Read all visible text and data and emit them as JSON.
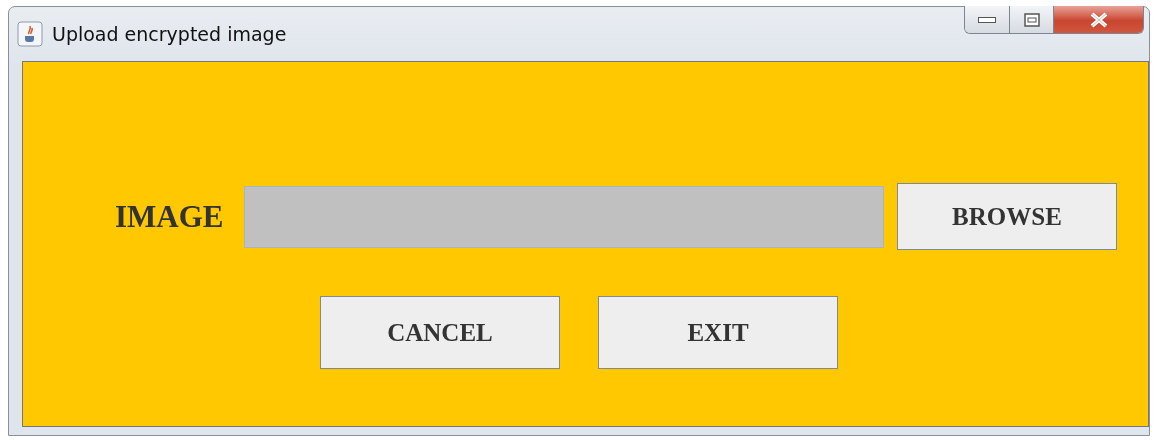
{
  "window": {
    "title": "Upload encrypted image"
  },
  "form": {
    "label": "IMAGE",
    "browse": "BROWSE"
  },
  "buttons": [
    {
      "label": "CANCEL"
    },
    {
      "label": "EXIT"
    }
  ]
}
